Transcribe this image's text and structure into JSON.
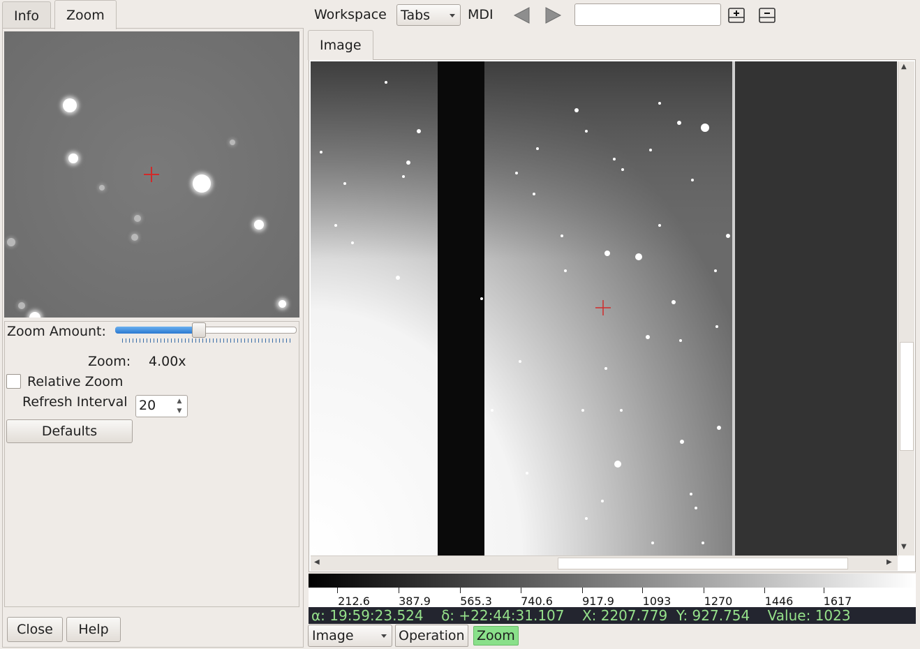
{
  "left_tabs": [
    {
      "label": "Info",
      "active": false
    },
    {
      "label": "Zoom",
      "active": true
    }
  ],
  "toolbar": {
    "workspace_label": "Workspace",
    "workspace_value": "Tabs",
    "mdi_label": "MDI",
    "search_value": "",
    "icons": [
      "back-arrow-icon",
      "forward-arrow-icon",
      "add-workspace-icon",
      "remove-workspace-icon"
    ]
  },
  "zoom_panel": {
    "zoom_amount_label": "Zoom Amount:",
    "zoom_amount_fraction": 0.46,
    "zoom_label": "Zoom:",
    "zoom_value": "4.00x",
    "relative_zoom_label": "Relative Zoom",
    "relative_zoom_checked": false,
    "refresh_interval_label": "Refresh Interval",
    "refresh_interval_value": "20",
    "defaults_button": "Defaults",
    "close_button": "Close",
    "help_button": "Help"
  },
  "image_tab": {
    "label": "Image"
  },
  "colorbar": {
    "ticks": [
      "212.6",
      "387.9",
      "565.3",
      "740.6",
      "917.9",
      "1093",
      "1270",
      "1446",
      "1617"
    ]
  },
  "status": {
    "text": "α: 19:59:23.524    δ: +22:44:31.107    X: 2207.779  Y: 927.754    Value: 1023"
  },
  "bottom_bar": {
    "image_select": "Image",
    "operation_button": "Operation",
    "zoom_button": "Zoom"
  },
  "colors": {
    "status_bg": "#23252f",
    "status_fg": "#96e28b",
    "zoom_active": "#8ae08a",
    "crosshair": "#d12a2a",
    "slider_fill": "#2a78d0"
  }
}
